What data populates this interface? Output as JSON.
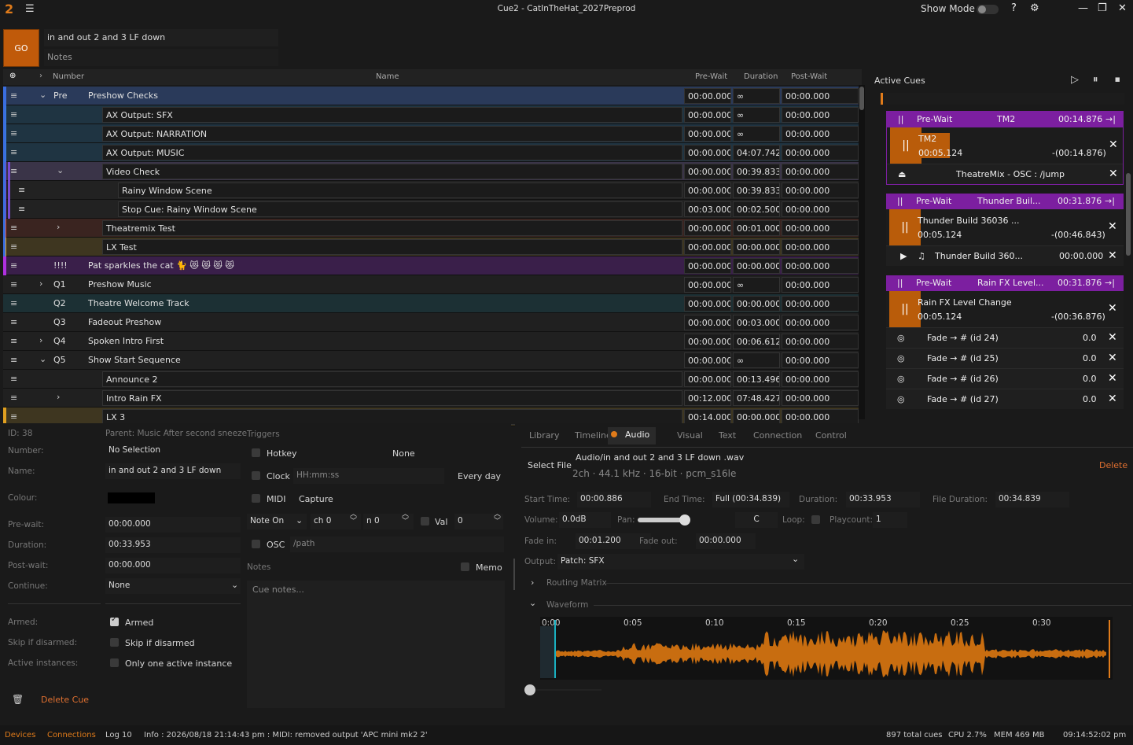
{
  "window": {
    "title": "Cue2 - CatInTheHat_2027Preprod",
    "show_mode": "Show Mode"
  },
  "go": {
    "label": "GO",
    "cue_name": "in and out 2 and 3 LF down",
    "notes_placeholder": "Notes"
  },
  "columns": {
    "number": "Number",
    "name": "Name",
    "prewait": "Pre-Wait",
    "duration": "Duration",
    "postwait": "Post-Wait"
  },
  "cues": [
    {
      "num": "Pre",
      "name": "Preshow Checks",
      "pre": "00:00.000",
      "dur": "∞",
      "post": "00:00.000",
      "color": "#2a3a5a",
      "bar": "#3a6ee0",
      "indent": 0,
      "exp": "v"
    },
    {
      "num": "",
      "name": "AX Output: SFX",
      "pre": "00:00.000",
      "dur": "∞",
      "post": "00:00.000",
      "color": "#1f3442",
      "bar": "#3a7ee0",
      "indent": 1,
      "exp": ""
    },
    {
      "num": "",
      "name": "AX Output: NARRATION",
      "pre": "00:00.000",
      "dur": "∞",
      "post": "00:00.000",
      "color": "#1f3442",
      "bar": "#3a7ee0",
      "indent": 1,
      "exp": ""
    },
    {
      "num": "",
      "name": "AX Output: MUSIC",
      "pre": "00:00.000",
      "dur": "04:07.742",
      "post": "00:00.000",
      "color": "#1f3442",
      "bar": "#3a7ee0",
      "indent": 1,
      "exp": ""
    },
    {
      "num": "",
      "name": "Video Check",
      "pre": "00:00.000",
      "dur": "00:39.833",
      "post": "00:00.000",
      "color": "#3a3448",
      "bar": "#7a4ad0",
      "indent": 1,
      "exp": "v"
    },
    {
      "num": "",
      "name": "Rainy Window Scene",
      "pre": "00:00.000",
      "dur": "00:39.833",
      "post": "00:00.000",
      "color": "#222",
      "bar": "#7a4ad0",
      "indent": 2,
      "exp": ""
    },
    {
      "num": "",
      "name": "Stop Cue: Rainy Window Scene",
      "pre": "00:03.000",
      "dur": "00:02.500",
      "post": "00:00.000",
      "color": "#222",
      "bar": "#7a4ad0",
      "indent": 2,
      "exp": ""
    },
    {
      "num": "",
      "name": "Theatremix Test",
      "pre": "00:00.000",
      "dur": "00:01.000",
      "post": "00:00.000",
      "color": "#3a2420",
      "bar": "#e0502a",
      "indent": 1,
      "exp": ">"
    },
    {
      "num": "",
      "name": "LX Test",
      "pre": "00:00.000",
      "dur": "00:00.000",
      "post": "00:00.000",
      "color": "#3e3620",
      "bar": "#e0a020",
      "indent": 1,
      "exp": ""
    },
    {
      "num": "!!!!",
      "name": "Pat sparkles the cat 🐈 😻 😻 😻 😻",
      "pre": "00:00.000",
      "dur": "00:00.000",
      "post": "00:00.000",
      "color": "#3a1f4a",
      "bar": "#b030e0",
      "indent": 0,
      "exp": ""
    },
    {
      "num": "Q1",
      "name": "Preshow Music",
      "pre": "00:00.000",
      "dur": "∞",
      "post": "00:00.000",
      "color": "#202020",
      "bar": "",
      "indent": 0,
      "exp": ">"
    },
    {
      "num": "Q2",
      "name": "Theatre Welcome Track",
      "pre": "00:00.000",
      "dur": "00:00.000",
      "post": "00:00.000",
      "color": "#1c3034",
      "bar": "",
      "indent": 0,
      "exp": ""
    },
    {
      "num": "Q3",
      "name": "Fadeout Preshow",
      "pre": "00:00.000",
      "dur": "00:03.000",
      "post": "00:00.000",
      "color": "#202020",
      "bar": "",
      "indent": 0,
      "exp": ""
    },
    {
      "num": "Q4",
      "name": "Spoken Intro First",
      "pre": "00:00.000",
      "dur": "00:06.612",
      "post": "00:00.000",
      "color": "#202020",
      "bar": "",
      "indent": 0,
      "exp": ">"
    },
    {
      "num": "Q5",
      "name": "Show Start Sequence",
      "pre": "00:00.000",
      "dur": "∞",
      "post": "00:00.000",
      "color": "#202020",
      "bar": "",
      "indent": 0,
      "exp": "v"
    },
    {
      "num": "",
      "name": "Announce 2",
      "pre": "00:00.000",
      "dur": "00:13.496",
      "post": "00:00.000",
      "color": "#202020",
      "bar": "",
      "indent": 1,
      "exp": ""
    },
    {
      "num": "",
      "name": "Intro Rain FX",
      "pre": "00:12.000",
      "dur": "07:48.427",
      "post": "00:00.000",
      "color": "#202020",
      "bar": "",
      "indent": 1,
      "exp": ">"
    },
    {
      "num": "",
      "name": "LX 3",
      "pre": "00:14.000",
      "dur": "00:00.000",
      "post": "00:00.000",
      "color": "#3e3620",
      "bar": "#e0a020",
      "indent": 1,
      "exp": ""
    }
  ],
  "active": {
    "title": "Active Cues",
    "c1": {
      "pw": "Pre-Wait",
      "name": "TM2",
      "time": "00:14.876",
      "bname": "TM2",
      "elapsed": "00:05.124",
      "remain": "-(00:14.876)",
      "sub": "TheatreMix - OSC : /jump"
    },
    "c2": {
      "pw": "Pre-Wait",
      "name": "Thunder Buil...",
      "time": "00:31.876",
      "bname": "Thunder Build 36036 ...",
      "elapsed": "00:05.124",
      "remain": "-(00:46.843)",
      "sub": "Thunder Build 360...",
      "subtime": "00:00.000"
    },
    "c3": {
      "pw": "Pre-Wait",
      "name": "Rain FX Level...",
      "time": "00:31.876",
      "bname": "Rain FX Level Change",
      "elapsed": "00:05.124",
      "remain": "-(00:36.876)"
    },
    "fades": [
      {
        "name": "Fade → # (id 24)",
        "val": "0.0"
      },
      {
        "name": "Fade → # (id 25)",
        "val": "0.0"
      },
      {
        "name": "Fade → # (id 26)",
        "val": "0.0"
      },
      {
        "name": "Fade → # (id 27)",
        "val": "0.0"
      }
    ]
  },
  "insp": {
    "id": "ID: 38",
    "parent": "Parent: Music After second sneeze",
    "triggers": "Triggers",
    "number_l": "Number:",
    "number_v": "No Selection",
    "name_l": "Name:",
    "name_v": "in and out 2 and 3 LF down",
    "colour_l": "Colour:",
    "prewait_l": "Pre-wait:",
    "prewait_v": "00:00.000",
    "duration_l": "Duration:",
    "duration_v": "00:33.953",
    "postwait_l": "Post-wait:",
    "postwait_v": "00:00.000",
    "continue_l": "Continue:",
    "continue_v": "None",
    "armed_l": "Armed:",
    "armed_v": "Armed",
    "skip_l": "Skip if disarmed:",
    "skip_v": "Skip if disarmed",
    "inst_l": "Active instances:",
    "inst_v": "Only one active instance",
    "delete": "Delete Cue",
    "hotkey": "Hotkey",
    "hotkey_v": "None",
    "clock": "Clock",
    "clock_ph": "HH:mm:ss",
    "clock_v": "Every day",
    "midi": "MIDI",
    "capture": "Capture",
    "noteon": "Note On",
    "ch": "ch 0",
    "n": "n 0",
    "val": "Val",
    "val_v": "0",
    "osc": "OSC",
    "osc_ph": "/path",
    "notes": "Notes",
    "memo": "Memo",
    "notes_ph": "Cue notes..."
  },
  "audio": {
    "tabs": [
      "Library",
      "Timeline",
      "Audio",
      "Visual",
      "Text",
      "Connection",
      "Control"
    ],
    "select": "Select File",
    "file": "Audio/in and out 2 and 3 LF down .wav",
    "fmt": "2ch · 44.1 kHz · 16-bit · pcm_s16le",
    "delete": "Delete",
    "start_l": "Start Time:",
    "start_v": "00:00.886",
    "end_l": "End Time:",
    "end_v": "Full (00:34.839)",
    "dur_l": "Duration:",
    "dur_v": "00:33.953",
    "fdur_l": "File Duration:",
    "fdur_v": "00:34.839",
    "vol_l": "Volume:",
    "vol_v": "0.0dB",
    "pan_l": "Pan:",
    "pan_v": "C",
    "loop_l": "Loop:",
    "play_l": "Playcount:",
    "play_v": "1",
    "fin_l": "Fade in:",
    "fin_v": "00:01.200",
    "fout_l": "Fade out:",
    "fout_v": "00:00.000",
    "out_l": "Output:",
    "out_v": "Patch: SFX",
    "routing": "Routing Matrix",
    "waveform": "Waveform",
    "ticks": [
      "0:00",
      "0:05",
      "0:10",
      "0:15",
      "0:20",
      "0:25",
      "0:30"
    ]
  },
  "status": {
    "devices": "Devices",
    "connections": "Connections",
    "log": "Log 10",
    "info": "Info  :  2026/08/18 21:14:43 pm  :  MIDI: removed output 'APC mini mk2 2'",
    "total": "897 total cues",
    "cpu": "CPU 2.7%",
    "mem": "MEM 469 MB",
    "clock": "09:14:52:02 pm"
  },
  "colors": {
    "accent": "#e07b1a",
    "prewait": "#7c1fa0"
  }
}
